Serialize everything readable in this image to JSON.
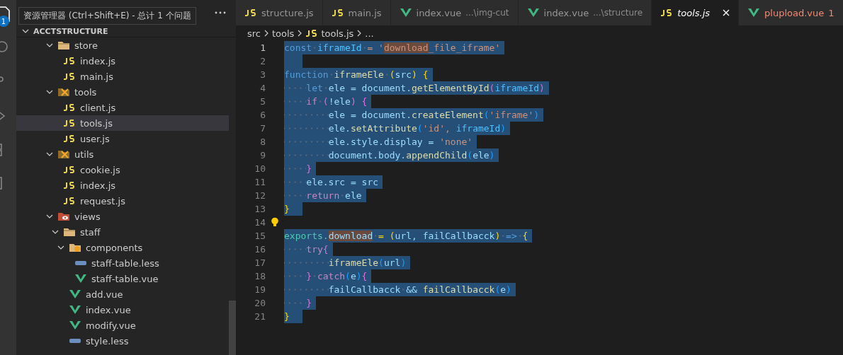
{
  "activity_bar": {
    "badge": "1"
  },
  "tooltip": {
    "text": "资源管理器 (Ctrl+Shift+E) - 总计 1 个问题"
  },
  "explorer": {
    "section": "ACCTSTRUCTURE",
    "tree": [
      {
        "label": "store",
        "kind": "folder",
        "expanded": true,
        "selected": false,
        "children": [
          {
            "label": "index.js",
            "kind": "js",
            "selected": false
          },
          {
            "label": "main.js",
            "kind": "js",
            "selected": false
          }
        ]
      },
      {
        "label": "tools",
        "kind": "folder-tools",
        "expanded": true,
        "selected": false,
        "children": [
          {
            "label": "client.js",
            "kind": "js",
            "selected": false
          },
          {
            "label": "tools.js",
            "kind": "js",
            "selected": true
          },
          {
            "label": "user.js",
            "kind": "js",
            "selected": false
          }
        ]
      },
      {
        "label": "utils",
        "kind": "folder-tools",
        "expanded": true,
        "selected": false,
        "children": [
          {
            "label": "cookie.js",
            "kind": "js",
            "selected": false
          },
          {
            "label": "index.js",
            "kind": "js",
            "selected": false
          },
          {
            "label": "request.js",
            "kind": "js",
            "selected": false
          }
        ]
      },
      {
        "label": "views",
        "kind": "folder-views",
        "expanded": true,
        "selected": false,
        "children": [
          {
            "label": "staff",
            "kind": "folder",
            "expanded": true,
            "selected": false,
            "children": [
              {
                "label": "components",
                "kind": "folder-components",
                "expanded": true,
                "selected": false,
                "children": [
                  {
                    "label": "staff-table.less",
                    "kind": "less",
                    "selected": false
                  },
                  {
                    "label": "staff-table.vue",
                    "kind": "vue",
                    "selected": false
                  }
                ]
              },
              {
                "label": "add.vue",
                "kind": "vue",
                "selected": false
              },
              {
                "label": "index.vue",
                "kind": "vue",
                "selected": false
              },
              {
                "label": "modify.vue",
                "kind": "vue",
                "selected": false
              },
              {
                "label": "style.less",
                "kind": "less",
                "selected": false
              }
            ]
          }
        ]
      }
    ]
  },
  "tabs": [
    {
      "label": "structure.js",
      "kind": "js",
      "selected": false
    },
    {
      "label": "main.js",
      "kind": "js",
      "selected": false
    },
    {
      "label": "index.vue",
      "description": "...\\img-cut",
      "kind": "vue",
      "selected": false
    },
    {
      "label": "index.vue",
      "description": "...\\structure",
      "kind": "vue",
      "selected": false
    },
    {
      "label": "tools.js",
      "kind": "js",
      "selected": true
    },
    {
      "label": "plupload.vue",
      "problems": "1",
      "kind": "vue",
      "selected": false,
      "error": true
    }
  ],
  "breadcrumb": [
    {
      "label": "src",
      "kind": "folder"
    },
    {
      "label": "tools",
      "kind": "folder"
    },
    {
      "label": "tools.js",
      "kind": "js"
    },
    {
      "label": "...",
      "kind": "more"
    }
  ],
  "code": [
    {
      "number": "1",
      "current": true,
      "selected": true,
      "tokens": [
        {
          "text": "const",
          "kind": "kw"
        },
        {
          "text": " iframeId",
          "kind": "const"
        },
        {
          "text": " = '",
          "kind": "str"
        },
        {
          "text": "download",
          "kind": "str-match"
        },
        {
          "text": "_file_iframe'",
          "kind": "str"
        }
      ]
    },
    {
      "number": "2",
      "current": false,
      "selected": true
    },
    {
      "number": "3",
      "current": false,
      "selected": true,
      "tokens": [
        {
          "text": "function",
          "kind": "kw"
        },
        {
          "text": " iframeEle",
          "kind": "fn"
        },
        {
          "text": " (",
          "kind": "b1"
        },
        {
          "text": "src",
          "kind": "var"
        },
        {
          "text": ") {",
          "kind": "b1"
        }
      ]
    },
    {
      "number": "4",
      "current": false,
      "selected": true,
      "tokens": [
        {
          "text": "    let",
          "kind": "kw"
        },
        {
          "text": " ele = document.",
          "kind": "var"
        },
        {
          "text": "getElementById",
          "kind": "fn"
        },
        {
          "text": "(",
          "kind": "b2"
        },
        {
          "text": "iframeId",
          "kind": "const"
        },
        {
          "text": ")",
          "kind": "b2"
        }
      ]
    },
    {
      "number": "5",
      "current": false,
      "selected": true,
      "tokens": [
        {
          "text": "    if",
          "kind": "ctl"
        },
        {
          "text": " (",
          "kind": "b2"
        },
        {
          "text": "!ele",
          "kind": "var"
        },
        {
          "text": ") {",
          "kind": "b2"
        }
      ]
    },
    {
      "number": "6",
      "current": false,
      "selected": true,
      "tokens": [
        {
          "text": "        ele = document.",
          "kind": "var"
        },
        {
          "text": "createElement",
          "kind": "fn"
        },
        {
          "text": "(",
          "kind": "b3"
        },
        {
          "text": "'iframe'",
          "kind": "str"
        },
        {
          "text": ")",
          "kind": "b3"
        }
      ]
    },
    {
      "number": "7",
      "current": false,
      "selected": true,
      "tokens": [
        {
          "text": "        ele.",
          "kind": "var"
        },
        {
          "text": "setAttribute",
          "kind": "fn"
        },
        {
          "text": "(",
          "kind": "b3"
        },
        {
          "text": "'id', ",
          "kind": "str"
        },
        {
          "text": "iframeId",
          "kind": "const"
        },
        {
          "text": ")",
          "kind": "b3"
        }
      ]
    },
    {
      "number": "8",
      "current": false,
      "selected": true,
      "tokens": [
        {
          "text": "        ele.style.display = ",
          "kind": "var"
        },
        {
          "text": "'none'",
          "kind": "str"
        }
      ]
    },
    {
      "number": "9",
      "current": false,
      "selected": true,
      "tokens": [
        {
          "text": "        document.body.",
          "kind": "var"
        },
        {
          "text": "appendChild",
          "kind": "fn"
        },
        {
          "text": "(",
          "kind": "b3"
        },
        {
          "text": "ele",
          "kind": "var"
        },
        {
          "text": ")",
          "kind": "b3"
        }
      ]
    },
    {
      "number": "10",
      "current": false,
      "selected": true,
      "tokens": [
        {
          "text": "    }",
          "kind": "b2"
        }
      ]
    },
    {
      "number": "11",
      "current": false,
      "selected": true,
      "tokens": [
        {
          "text": "    ele.src = src",
          "kind": "var"
        }
      ]
    },
    {
      "number": "12",
      "current": false,
      "selected": true,
      "tokens": [
        {
          "text": "    return",
          "kind": "ctl"
        },
        {
          "text": " ele",
          "kind": "var"
        }
      ]
    },
    {
      "number": "13",
      "current": false,
      "selected": true,
      "tokens": [
        {
          "text": "}",
          "kind": "b1"
        }
      ]
    },
    {
      "number": "14",
      "current": false,
      "selected": false,
      "lightbulb": true
    },
    {
      "number": "15",
      "current": false,
      "selected": true,
      "tokens": [
        {
          "text": "exports.",
          "kind": "type"
        },
        {
          "text": "download",
          "kind": "var-match"
        },
        {
          "text": " = (",
          "kind": "b1"
        },
        {
          "text": "url, failCallbacck",
          "kind": "var"
        },
        {
          "text": ")",
          "kind": "b1"
        },
        {
          "text": " =>",
          "kind": "kw"
        },
        {
          "text": " {",
          "kind": "b1"
        }
      ]
    },
    {
      "number": "16",
      "current": false,
      "selected": true,
      "tokens": [
        {
          "text": "    try",
          "kind": "ctl"
        },
        {
          "text": "{",
          "kind": "b2"
        }
      ]
    },
    {
      "number": "17",
      "current": false,
      "selected": true,
      "tokens": [
        {
          "text": "        iframeEle",
          "kind": "fn"
        },
        {
          "text": "(",
          "kind": "b3"
        },
        {
          "text": "url",
          "kind": "var"
        },
        {
          "text": ")",
          "kind": "b3"
        }
      ]
    },
    {
      "number": "18",
      "current": false,
      "selected": true,
      "tokens": [
        {
          "text": "    }",
          "kind": "b2"
        },
        {
          "text": " catch",
          "kind": "ctl"
        },
        {
          "text": "(",
          "kind": "b3"
        },
        {
          "text": "e",
          "kind": "var"
        },
        {
          "text": ")",
          "kind": "b3"
        },
        {
          "text": "{",
          "kind": "b2"
        }
      ]
    },
    {
      "number": "19",
      "current": false,
      "selected": true,
      "tokens": [
        {
          "text": "        failCallbacck",
          "kind": "var"
        },
        {
          "text": " && ",
          "kind": "var"
        },
        {
          "text": "failCallbacck",
          "kind": "fn"
        },
        {
          "text": "(",
          "kind": "b3"
        },
        {
          "text": "e",
          "kind": "var"
        },
        {
          "text": ")",
          "kind": "b3"
        }
      ]
    },
    {
      "number": "20",
      "current": false,
      "selected": true,
      "tokens": [
        {
          "text": "    }",
          "kind": "b2"
        }
      ]
    },
    {
      "number": "21",
      "current": false,
      "selected": true,
      "tokens": [
        {
          "text": "}",
          "kind": "b1"
        }
      ]
    }
  ]
}
